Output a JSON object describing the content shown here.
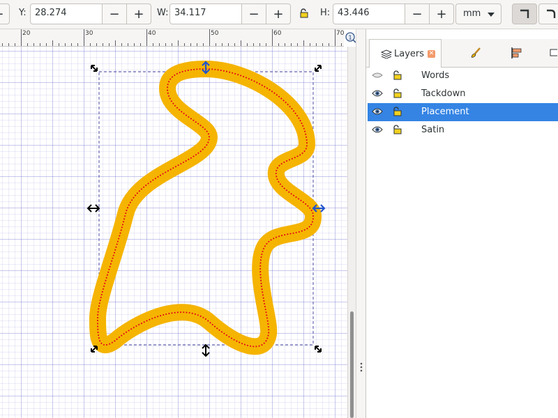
{
  "toolbar": {
    "y_label": "Y:",
    "y_value": "28.274",
    "w_label": "W:",
    "w_value": "34.117",
    "h_label": "H:",
    "h_value": "43.446",
    "unit": "mm",
    "plus": "+",
    "minus": "−"
  },
  "ruler": {
    "labels": [
      "20",
      "30",
      "40",
      "50",
      "60",
      "70"
    ]
  },
  "panel": {
    "tabs": [
      {
        "label": "Layers",
        "icon": "layers-icon"
      },
      {
        "label": "",
        "icon": "paint-brush-icon"
      },
      {
        "label": "",
        "icon": "align-icon"
      },
      {
        "label": "",
        "icon": "message-icon"
      }
    ],
    "layers": [
      {
        "name": "Words",
        "visible": false,
        "selected": false
      },
      {
        "name": "Tackdown",
        "visible": true,
        "selected": false
      },
      {
        "name": "Placement",
        "visible": true,
        "selected": true
      },
      {
        "name": "Satin",
        "visible": true,
        "selected": false
      }
    ]
  },
  "colors": {
    "stroke": "#f5b400",
    "dotted_path": "#e0001a",
    "selection": "#3584e4",
    "bbox_dash": "#3a3a9a"
  }
}
